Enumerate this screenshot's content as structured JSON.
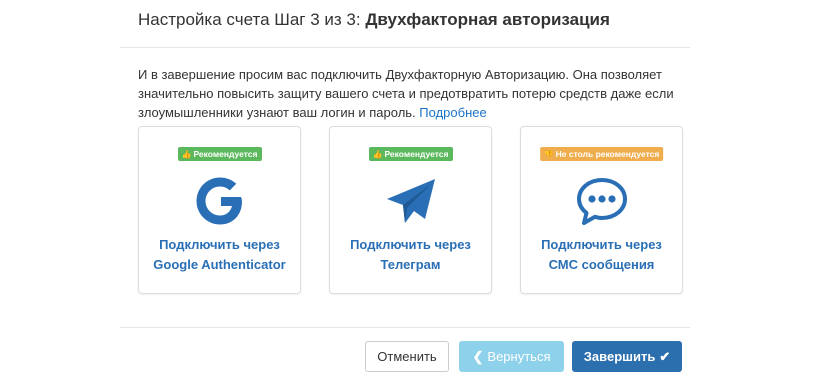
{
  "header": {
    "prefix": "Настройка счета Шаг 3 из 3:",
    "title": "Двухфакторная авторизация"
  },
  "intro": {
    "text": "И в завершение просим вас подключить Двухфакторную Авторизацию. Она позволяет значительно повысить защиту вашего счета и предотвратить потерю средств даже если злоумышленники узнают ваш логин и пароль.",
    "link": "Подробнее"
  },
  "cards": [
    {
      "badge": "Рекомендуется",
      "badge_color": "#5cb85c",
      "badge_icon": "thumbs-up-icon",
      "icon": "google-icon",
      "line1": "Подключить через",
      "line2": "Google Authenticator"
    },
    {
      "badge": "Рекомендуется",
      "badge_color": "#5cb85c",
      "badge_icon": "thumbs-up-icon",
      "icon": "telegram-icon",
      "line1": "Подключить через",
      "line2": "Телеграм"
    },
    {
      "badge": "Не столь рекомендуется",
      "badge_color": "#f0ad4e",
      "badge_icon": "thumbs-down-icon",
      "icon": "sms-chat-icon",
      "line1": "Подключить через",
      "line2": "СМС сообщения"
    }
  ],
  "buttons": {
    "cancel": "Отменить",
    "back": "Вернуться",
    "finish": "Завершить"
  },
  "colors": {
    "accent": "#2c6fae",
    "link": "#1a73c9",
    "back_button": "#8ed1ea"
  }
}
